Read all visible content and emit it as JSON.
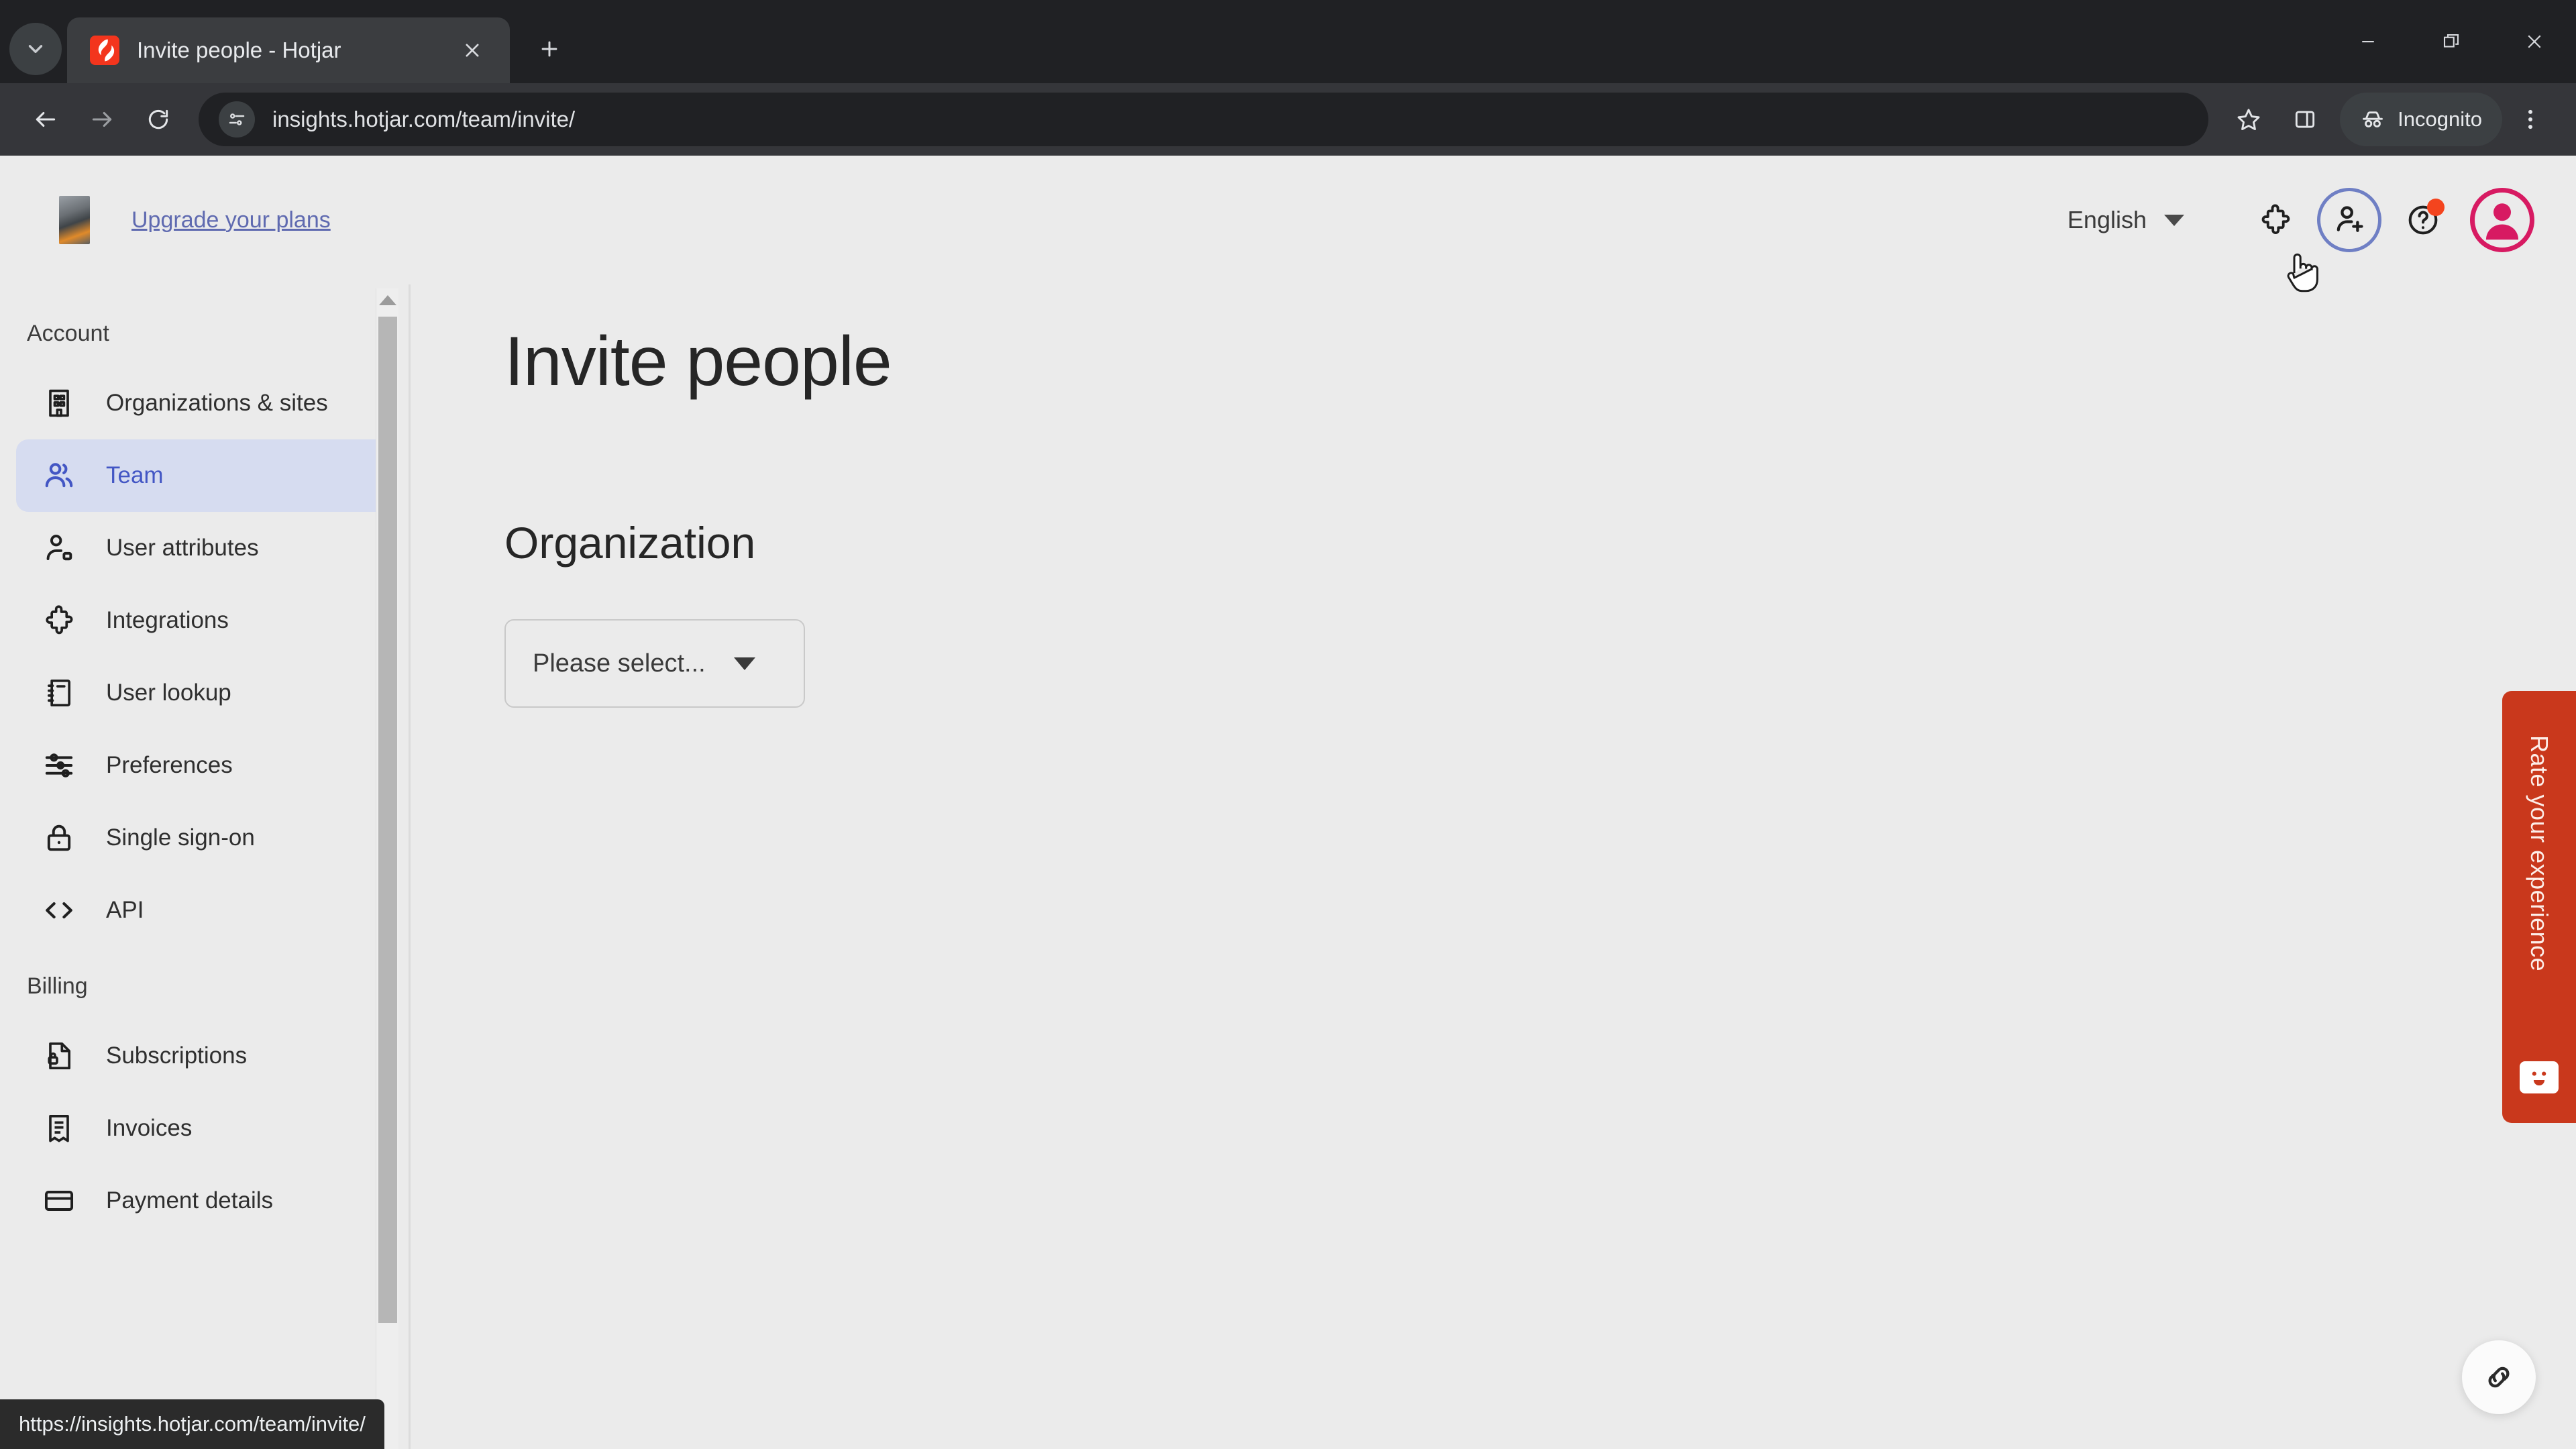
{
  "browser": {
    "tab": {
      "title": "Invite people - Hotjar",
      "favicon": "hotjar-flame-icon"
    },
    "tab_search_icon": "chevron-down-icon",
    "new_tab_label": "+",
    "window_controls": {
      "minimize": "minimize-icon",
      "maximize": "restore-icon",
      "close": "close-icon"
    },
    "nav": {
      "back": "back-arrow-icon",
      "forward": "forward-arrow-icon",
      "reload": "reload-icon"
    },
    "omnibox": {
      "url": "insights.hotjar.com/team/invite/",
      "site_info_icon": "site-settings-icon"
    },
    "actions": {
      "bookmark_icon": "star-icon",
      "sidepanel_icon": "side-panel-icon",
      "incognito_label": "Incognito",
      "incognito_icon": "incognito-spy-icon",
      "menu_icon": "three-dot-menu-icon"
    },
    "status_bar_url": "https://insights.hotjar.com/team/invite/"
  },
  "appheader": {
    "thumbnail": "account-thumbnail",
    "upgrade_link": "Upgrade your plans",
    "language": {
      "label": "English",
      "caret": "chevron-down-icon"
    },
    "icons": {
      "extensions": "puzzle-piece-icon",
      "invite_people": "person-add-icon",
      "help": "help-circle-icon",
      "avatar": "user-avatar-icon"
    }
  },
  "sidebar": {
    "sections": [
      {
        "title": "Account",
        "items": [
          {
            "label": "Organizations & sites",
            "icon": "building-icon",
            "active": false
          },
          {
            "label": "Team",
            "icon": "users-icon",
            "active": true
          },
          {
            "label": "User attributes",
            "icon": "user-tag-icon",
            "active": false
          },
          {
            "label": "Integrations",
            "icon": "puzzle-piece-icon",
            "active": false
          },
          {
            "label": "User lookup",
            "icon": "notebook-icon",
            "active": false
          },
          {
            "label": "Preferences",
            "icon": "sliders-icon",
            "active": false
          },
          {
            "label": "Single sign-on",
            "icon": "lock-icon",
            "active": false
          },
          {
            "label": "API",
            "icon": "code-brackets-icon",
            "active": false
          }
        ]
      },
      {
        "title": "Billing",
        "items": [
          {
            "label": "Subscriptions",
            "icon": "document-lock-icon",
            "active": false
          },
          {
            "label": "Invoices",
            "icon": "receipt-icon",
            "active": false
          },
          {
            "label": "Payment details",
            "icon": "credit-card-icon",
            "active": false
          }
        ]
      }
    ]
  },
  "main": {
    "page_title": "Invite people",
    "section_title": "Organization",
    "organization_select": {
      "value": "Please select...",
      "caret": "caret-down-icon"
    }
  },
  "widgets": {
    "feedback_tab": {
      "label": "Rate your experience",
      "icon": "smiley-face-icon"
    },
    "link_button": {
      "icon": "chain-link-icon"
    }
  },
  "colors": {
    "accent_blue": "#4356c4",
    "active_pill": "#d6dcf0",
    "avatar_ring": "#d71a62",
    "feedback_red": "#c9381c",
    "notif_dot": "#f4441e",
    "page_bg": "#ebebeb",
    "chrome_dark": "#202124"
  }
}
